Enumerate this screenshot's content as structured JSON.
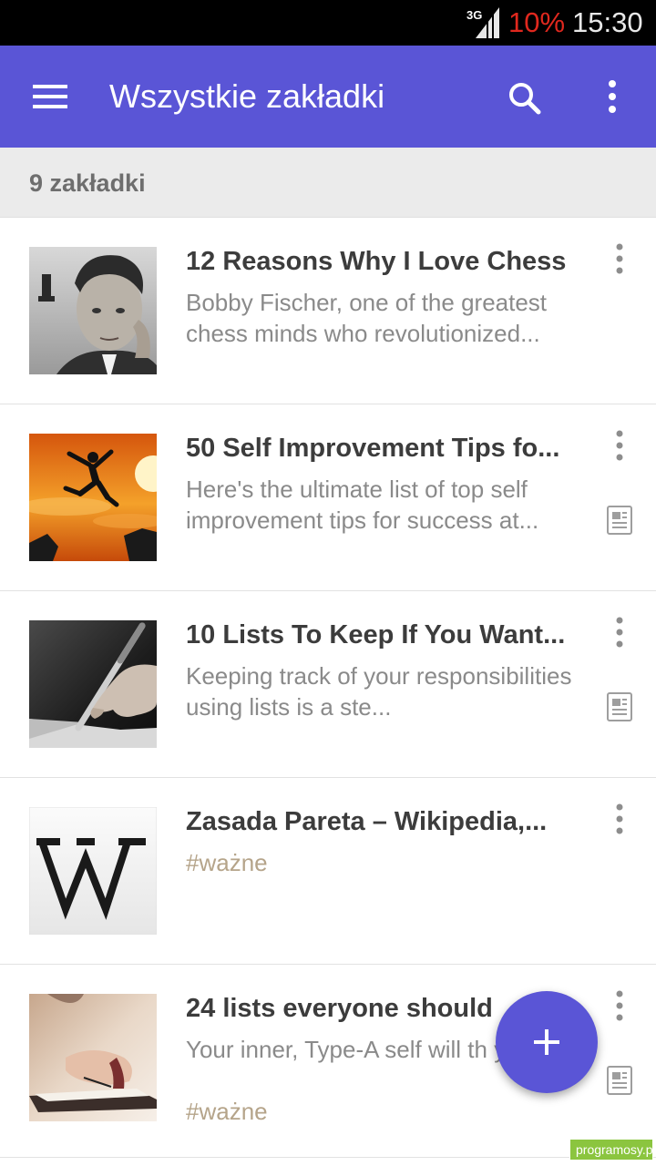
{
  "status_bar": {
    "network_label": "3G",
    "battery": "10%",
    "time": "15:30",
    "battery_color": "#e0281e"
  },
  "app_bar": {
    "title": "Wszystkie zakładki",
    "menu_icon": "hamburger-menu-icon",
    "search_icon": "search-icon",
    "more_icon": "more-vert-icon",
    "color": "#5a55d6"
  },
  "count_header": {
    "text": "9 zakładki"
  },
  "items": [
    {
      "title": "12 Reasons Why I Love Chess",
      "description": "Bobby Fischer, one of the greatest chess minds who revolutionized...",
      "tag": "",
      "thumbnail": "chess-player-portrait",
      "has_article": false
    },
    {
      "title": "50 Self Improvement Tips fo...",
      "description": "Here's the ultimate list of top self improvement tips for success at...",
      "tag": "",
      "thumbnail": "jumping-silhouette-sunset",
      "has_article": true
    },
    {
      "title": "10 Lists To Keep If You Want...",
      "description": "Keeping track of your responsibilities using lists is a ste...",
      "tag": "",
      "thumbnail": "hand-writing-with-pen",
      "has_article": true
    },
    {
      "title": "Zasada Pareta – Wikipedia,...",
      "description": "",
      "tag": "#ważne",
      "thumbnail": "wikipedia-logo",
      "has_article": false
    },
    {
      "title": "24 lists everyone should",
      "description": "Your inner, Type-A self will th you.",
      "tag": "#ważne",
      "thumbnail": "hand-writing-notebook",
      "has_article": true
    }
  ],
  "fab": {
    "icon": "plus-icon"
  },
  "watermark": {
    "text": "programosy.pl"
  }
}
